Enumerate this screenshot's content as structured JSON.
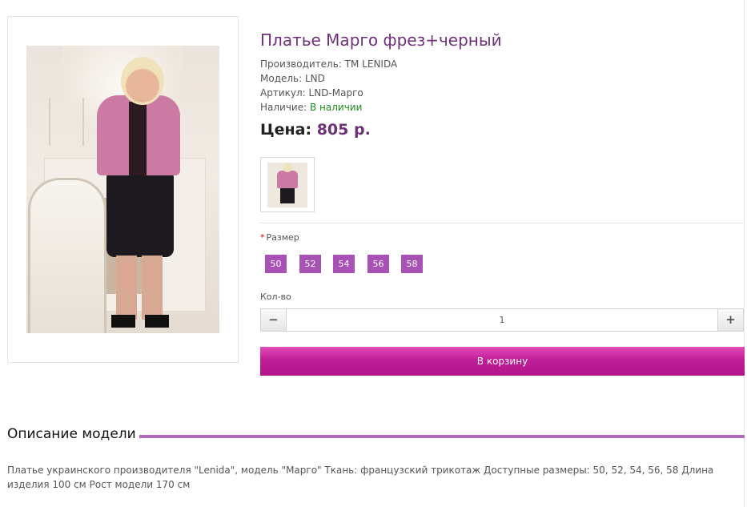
{
  "product": {
    "title": "Платье Марго фрез+черный",
    "manufacturer_label": "Производитель:",
    "manufacturer": "ТМ LENIDA",
    "model_label": "Модель:",
    "model": "LND",
    "sku_label": "Артикул:",
    "sku": "LND-Марго",
    "stock_label": "Наличие:",
    "stock": "В наличии",
    "price_label": "Цена:",
    "price": "805 р."
  },
  "options": {
    "size_label": "Размер",
    "sizes": [
      "50",
      "52",
      "54",
      "56",
      "58"
    ]
  },
  "quantity": {
    "label": "Кол-во",
    "minus": "−",
    "value": "1",
    "plus": "+"
  },
  "cart": {
    "button_label": "В корзину"
  },
  "description": {
    "title": "Описание модели",
    "text": "Платье украинского производителя \"Lenida\", модель \"Марго\" Ткань: французский трикотаж Доступные размеры: 50, 52, 54, 56, 58 Длина изделия 100 см Рост модели 170 см"
  },
  "colors": {
    "accent": "#6e3178",
    "size_button": "#a952b6",
    "cart_button": "#c01e97",
    "in_stock": "#1f8a1f"
  }
}
